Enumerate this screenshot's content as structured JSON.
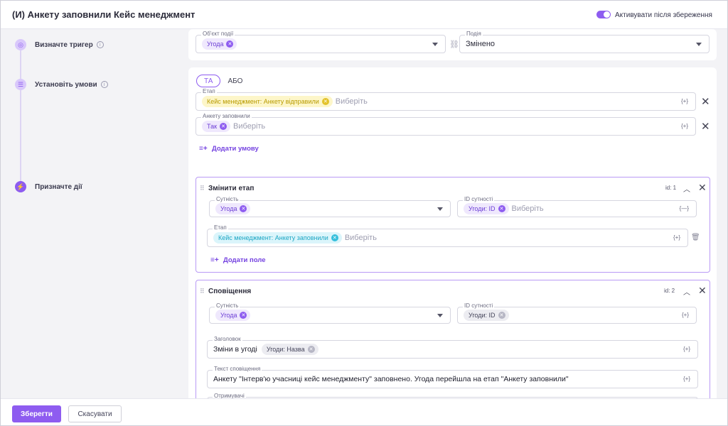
{
  "header": {
    "title": "(И) Анкету заповнили Кейс менеджмент",
    "toggle_label": "Активувати після збереження",
    "toggle_on": true,
    "accent_color": "#8e5cf0"
  },
  "steps": {
    "trigger": {
      "label": "Визначте тригер",
      "icon": "trigger-icon"
    },
    "conditions": {
      "label": "Установіть умови",
      "icon": "conditions-icon"
    },
    "actions": {
      "label": "Призначте дії",
      "icon": "actions-icon"
    }
  },
  "trigger": {
    "object_label": "Об'єкт події",
    "object_chip": "Угода",
    "event_label": "Подія",
    "event_value": "Змінено"
  },
  "conditions": {
    "tab_and": "ТА",
    "tab_or": "АБО",
    "stage": {
      "label": "Етап",
      "chip": "Кейс менеджмент: Анкету відправили",
      "placeholder": "Виберіть",
      "var": "{+}"
    },
    "survey": {
      "label": "Анкету заповнили",
      "chip": "Так",
      "placeholder": "Виберіть",
      "var": "{+}"
    },
    "add_label": "Додати умову"
  },
  "actions": [
    {
      "title": "Змінити етап",
      "id": "id: 1",
      "entity_label": "Сутність",
      "entity_chip": "Угода",
      "entity_id_label": "ID сутності",
      "entity_id_chip": "Угоди: ID",
      "entity_id_placeholder": "Виберіть",
      "entity_id_var": "{—}",
      "stage_label": "Етап",
      "stage_chip": "Кейс менеджмент: Анкету заповнили",
      "stage_placeholder": "Виберіть",
      "stage_var": "{+}",
      "add_field": "Додати поле"
    },
    {
      "title": "Сповіщення",
      "id": "id: 2",
      "entity_label": "Сутність",
      "entity_chip": "Угода",
      "entity_id_label": "ID сутності",
      "entity_id_chip": "Угоди: ID",
      "entity_id_var": "{+}",
      "heading_label": "Заголовок",
      "heading_text": "Зміни в угоді",
      "heading_chip": "Угоди: Назва",
      "heading_var": "{+}",
      "body_label": "Текст сповіщення",
      "body_text": "Анкету \"Інтерв'ю учасниці кейс менеджменту\" заповнено. Угода перейшла на етап \"Анкету заповнили\"",
      "body_var": "{+}",
      "recipients_label": "Отримувачі"
    }
  ],
  "footer": {
    "save": "Зберегти",
    "cancel": "Скасувати"
  }
}
